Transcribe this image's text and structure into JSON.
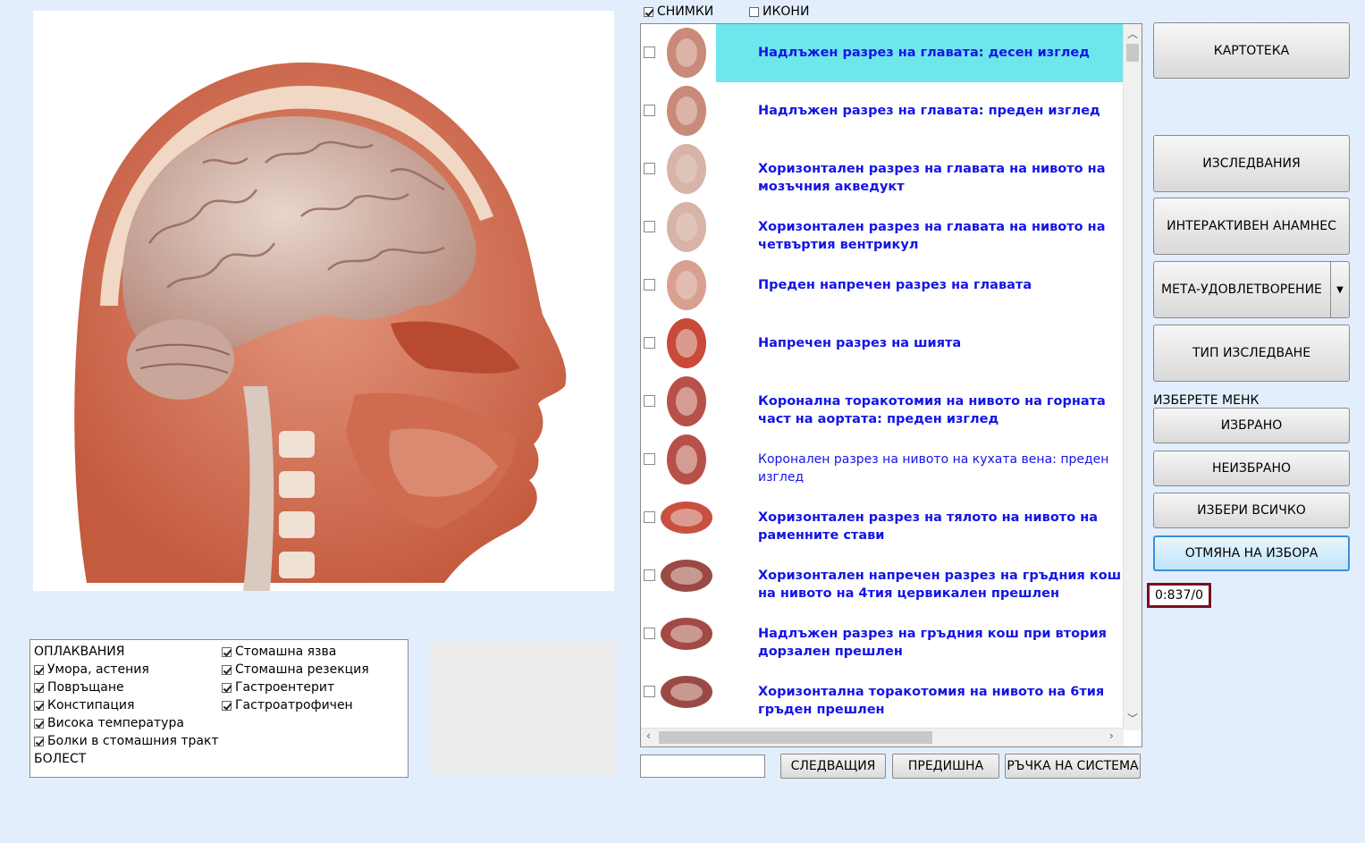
{
  "toggles": {
    "photos_label": "СНИМКИ",
    "photos_checked": true,
    "icons_label": "ИКОНИ",
    "icons_checked": false
  },
  "list_items": [
    {
      "label": "Надлъжен разрез на главата: десен изглед",
      "selected": true,
      "bold": true
    },
    {
      "label": "Надлъжен разрез на главата: преден изглед",
      "bold": true
    },
    {
      "label": "Хоризонтален разрез на главата на нивото на мозъчния акведукт",
      "bold": true
    },
    {
      "label": "Хоризонтален разрез на главата на нивото на четвъртия вентрикул",
      "bold": true
    },
    {
      "label": "Преден напречен разрез на главата",
      "bold": true
    },
    {
      "label": "Напречен разрез на шията",
      "bold": true
    },
    {
      "label": "Коронална торакотомия на нивото на горната част на аортата: преден изглед",
      "bold": true
    },
    {
      "label": "Коронален разрез на нивото на кухата вена: преден изглед",
      "bold": false
    },
    {
      "label": "Хоризонтален разрез на тялото на нивото на раменните стави",
      "bold": true
    },
    {
      "label": "Хоризонтален напречен разрез на гръдния кош на нивото на 4тия цервикален прешлен",
      "bold": true
    },
    {
      "label": "Надлъжен разрез на гръдния кош при втория дорзален прешлен",
      "bold": true
    },
    {
      "label": "Хоризонтална торакотомия на нивото на 6тия гръден прешлен",
      "bold": true
    }
  ],
  "complaints": {
    "header": "ОПЛАКВАНИЯ",
    "col1": [
      "Умора, астения",
      "Повръщане",
      "Констипация",
      "Висока температура",
      "Болки в стомашния тракт"
    ],
    "footer": "БОЛЕСТ",
    "col2": [
      "Стомашна язва",
      "Стомашна резекция",
      "Гастроентерит",
      "Гастроатрофичен"
    ]
  },
  "nav": {
    "next": "СЛЕДВАЩИЯ",
    "prev": "ПРЕДИШНА",
    "manual": "РЪЧКА НА СИСТЕМА"
  },
  "right": {
    "card_index": "КАРТОТЕКА",
    "studies": "ИЗСЛЕДВАНИЯ",
    "anamnesis": "ИНТЕРАКТИВЕН АНАМНЕС",
    "meta": "МЕТА-УДОВЛЕТВОРЕНИЕ",
    "study_type": "ТИП ИЗСЛЕДВАНЕ",
    "select_label": "ИЗБЕРЕТЕ МЕНК",
    "selected": "ИЗБРАНО",
    "unselected": "НЕИЗБРАНО",
    "select_all": "ИЗБЕРИ ВСИЧКО",
    "cancel": "ОТМЯНА НА ИЗБОРА"
  },
  "counter": "0:837/0",
  "colors": {
    "background": "#e3eefc",
    "selection": "#6de6ec",
    "link_text": "#1414e6",
    "counter_border": "#7a1020"
  }
}
